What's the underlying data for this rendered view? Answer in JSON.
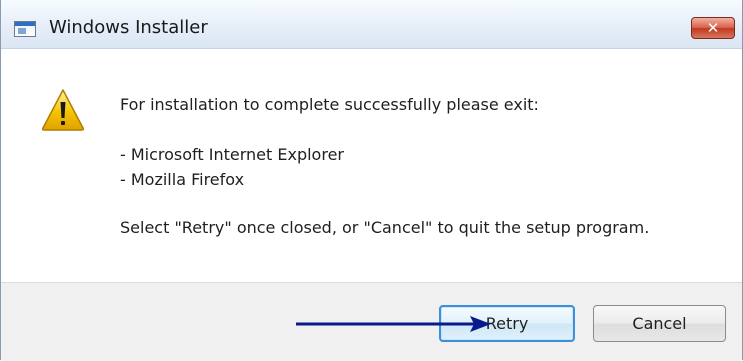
{
  "window": {
    "title": "Windows Installer",
    "close_glyph": "✕"
  },
  "message": {
    "line1": "For installation to complete successfully please exit:",
    "items": [
      "- Microsoft Internet Explorer",
      "- Mozilla Firefox"
    ],
    "instruction": "Select \"Retry\" once closed, or \"Cancel\" to quit the setup program."
  },
  "buttons": {
    "retry_label": "Retry",
    "cancel_label": "Cancel"
  },
  "icons": {
    "app": "installer-window-icon",
    "warning": "warning-icon",
    "annotation": "annotation-arrow"
  },
  "colors": {
    "annotation_arrow": "#0a1a8c",
    "warning_fill": "#f5c400",
    "close_button": "#c8472f",
    "focus_border": "#3c8fd8"
  }
}
